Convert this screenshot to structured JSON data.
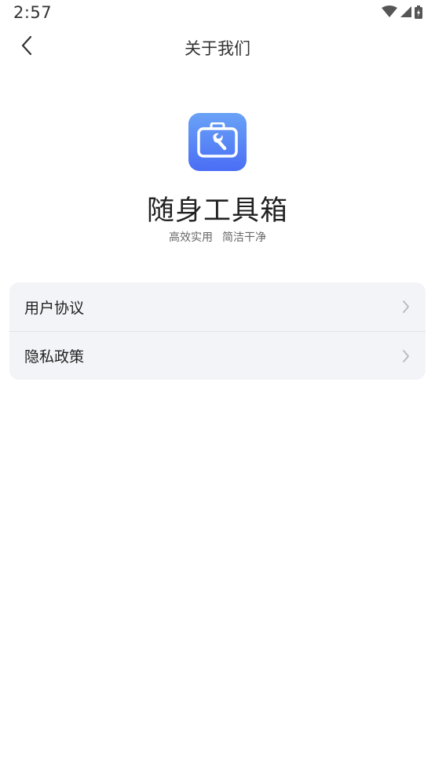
{
  "status_bar": {
    "time": "2:57",
    "icons": [
      "wifi-icon",
      "signal-icon",
      "battery-icon"
    ]
  },
  "nav": {
    "title": "关于我们",
    "back_icon": "chevron-left-icon"
  },
  "app": {
    "logo_icon": "toolbox-wrench-icon",
    "name": "随身工具箱",
    "slogan": [
      "高效实用",
      "简洁干净"
    ]
  },
  "menu": {
    "items": [
      {
        "label": "用户协议",
        "icon": "chevron-right-icon"
      },
      {
        "label": "隐私政策",
        "icon": "chevron-right-icon"
      }
    ]
  },
  "colors": {
    "accent_top": "#6aa2f7",
    "accent_bottom": "#4a6ef5",
    "card_bg": "#f3f4f8",
    "text_primary": "#222222",
    "text_secondary": "#666666"
  }
}
